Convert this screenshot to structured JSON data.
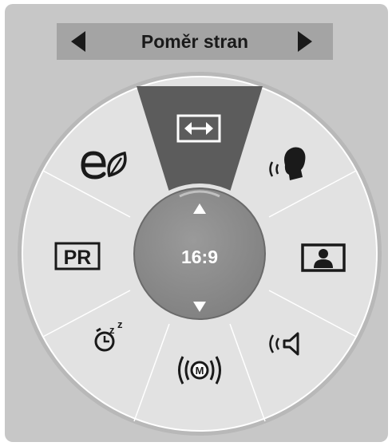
{
  "menu": {
    "title": "Poměr stran",
    "current_value": "16:9",
    "items": [
      {
        "id": "aspect-ratio",
        "icon": "aspect-ratio-icon",
        "selected": true
      },
      {
        "id": "voice",
        "icon": "speaking-head-icon",
        "selected": false
      },
      {
        "id": "picture",
        "icon": "picture-mode-icon",
        "selected": false
      },
      {
        "id": "sound",
        "icon": "speaker-icon",
        "selected": false
      },
      {
        "id": "mute",
        "icon": "mute-m-icon",
        "selected": false
      },
      {
        "id": "sleep-timer",
        "icon": "sleep-timer-icon",
        "selected": false
      },
      {
        "id": "pr",
        "label": "PR",
        "icon": "pr-label-icon",
        "selected": false
      },
      {
        "id": "energy",
        "icon": "eco-leaf-icon",
        "selected": false
      }
    ]
  },
  "colors": {
    "panel": "#c7c7c7",
    "title_bar": "#a4a4a4",
    "wheel": "#e0e0e0",
    "selected_sector": "#5c5c5c",
    "center_hub": "#8e8e8e",
    "icon": "#1a1a1a"
  }
}
